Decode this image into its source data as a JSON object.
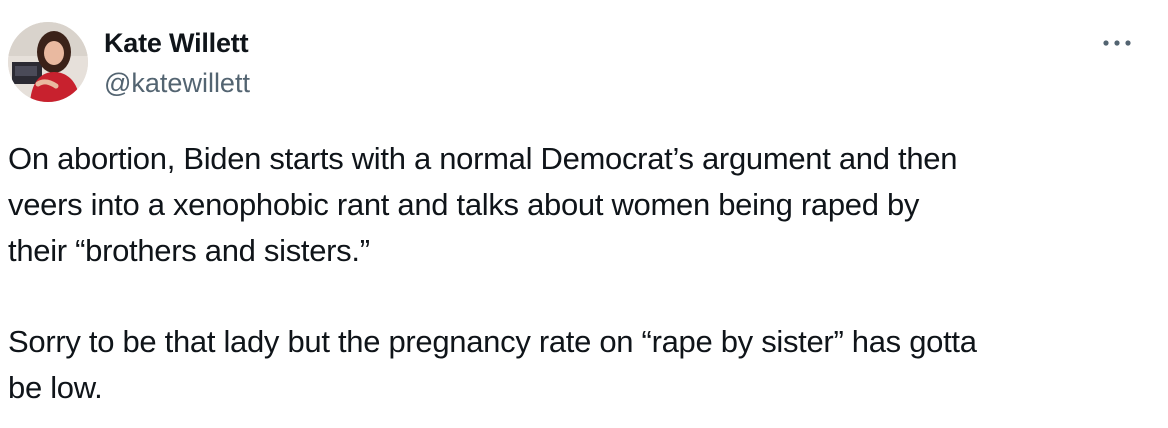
{
  "author": {
    "name": "Kate Willett",
    "handle": "@katewillett"
  },
  "menu_icon": "more-horizontal-icon",
  "avatar_icon": "profile-photo",
  "tweet": {
    "paragraphs": [
      "On abortion, Biden starts with a normal Democrat’s argument and then\nveers into a xenophobic rant and talks about women being raped by\ntheir “brothers and sisters.”",
      "Sorry to be that lady but the pregnancy rate on “rape by sister” has gotta\nbe low."
    ]
  },
  "colors": {
    "text": "#0f1419",
    "secondary_text": "#536471",
    "background": "#ffffff"
  }
}
